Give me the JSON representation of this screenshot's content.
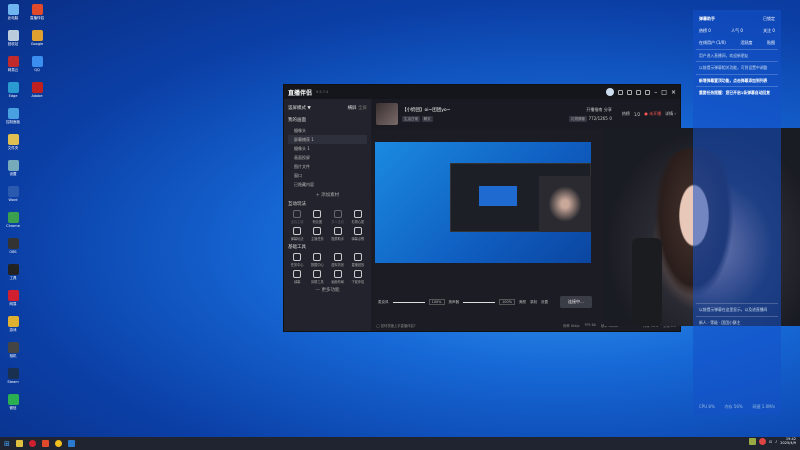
{
  "desktop_icons": [
    {
      "label": "此电脑",
      "color": "#6fb6f0"
    },
    {
      "label": "直播伴侣",
      "color": "#e04a2a"
    },
    {
      "label": "回收站",
      "color": "#bcd"
    },
    {
      "label": "Google",
      "color": "#e0a030"
    },
    {
      "label": "网易云",
      "color": "#c02a2a"
    },
    {
      "label": "QQ",
      "color": "#3a8ef0"
    },
    {
      "label": "Edge",
      "color": "#2a9ad0"
    },
    {
      "label": "Adobe",
      "color": "#c02020"
    },
    {
      "label": "控制面板",
      "color": "#48a0e0"
    },
    {
      "label": "文件夹",
      "color": "#e0c050"
    },
    {
      "label": "设置",
      "color": "#7ab"
    },
    {
      "label": "Word",
      "color": "#2a5ab0"
    },
    {
      "label": "Chrome",
      "color": "#3aa050"
    },
    {
      "label": "OBS",
      "color": "#333"
    },
    {
      "label": "工具",
      "color": "#222"
    },
    {
      "label": "网易",
      "color": "#d02030"
    },
    {
      "label": "游戏",
      "color": "#e0b030"
    },
    {
      "label": "相机",
      "color": "#444"
    },
    {
      "label": "Steam",
      "color": "#1a3050"
    },
    {
      "label": "微信",
      "color": "#2ab050"
    }
  ],
  "app": {
    "title": "直播伴侣",
    "version": "9.5.7.4",
    "mode": "竖屏模式 ▼",
    "tab_scene": "横屏",
    "tab_all": "全屏",
    "section_sources": "我的画面",
    "sources": [
      "摄像头",
      "屏幕捕获 1",
      "摄像头 1",
      "画面投屏",
      "图片文件",
      "窗口",
      "已隐藏内容"
    ],
    "add_source": "+ 添加素材",
    "section_interact": "互动玩法",
    "interact": [
      "连线主播",
      "粉丝团",
      "多人连线",
      "礼物心愿",
      "弹幕玩法",
      "主播任务",
      "投屏助手",
      "弹幕点歌"
    ],
    "section_tools": "基础工具",
    "tools": [
      "任务中心",
      "数据中心",
      "虚拟背景",
      "直播回放",
      "绿幕",
      "剪辑工具",
      "画面布局",
      "下载伴侣"
    ],
    "more": "— 更多功能",
    "room_title": "【小奶团】oi~团团yo~",
    "room_tag1": "生活日常",
    "room_tag2": "聊天",
    "btn_rank": "开播指南",
    "btn_share": "分享",
    "btn_gift": "礼物屏蔽",
    "viewers": "772/1265",
    "likes": "0",
    "right_tab1": "热榜",
    "right_tab2": "1/2",
    "live_status": "● 未开播",
    "detail": "详情 ›",
    "mic_label": "麦克风",
    "mic_pct": "100%",
    "speaker_label": "扬声器",
    "speaker_pct": "100%",
    "ctl_effects": "美颜",
    "ctl_record": "录制",
    "ctl_settings": "设置",
    "go_live": "连接中...",
    "tip": "◯ 如何快速上手直播伴侣?",
    "stats": [
      "码率 0kb/s",
      "FPS 60",
      "帧率 60/60",
      "CPU 12%",
      "内存 56%",
      "丢帧 0%"
    ]
  },
  "assistant": {
    "title": "弹幕助手",
    "btn": "已锁定",
    "stats": [
      "热榜 0",
      "人气 0",
      "关注 0"
    ],
    "tabs": [
      "在线用户 (1/0)",
      "活跃度",
      "贴图"
    ],
    "messages": [
      {
        "text": "用户进入直播间，欢迎新朋友",
        "hi": false
      },
      {
        "text": "以前提示弹幕相关功能，可到设置中调整",
        "hi": false
      },
      {
        "text": "新增弹幕置顶功能，点击弹幕添加到列表",
        "hi": true
      },
      {
        "text": "重要任务提醒：您已开启1条弹幕自动回复",
        "hi": true
      },
      {
        "text": "以前提示弹幕在这里显示，以及进直播间",
        "hi": false
      },
      {
        "text": "新人 · 等级 · 团团小酥主",
        "hi": false
      }
    ],
    "footer": [
      "CPU 8%",
      "内存 56%",
      "网速 1.0M/s"
    ]
  },
  "taskbar": {
    "time": "19:42",
    "date": "2025/4/9"
  }
}
